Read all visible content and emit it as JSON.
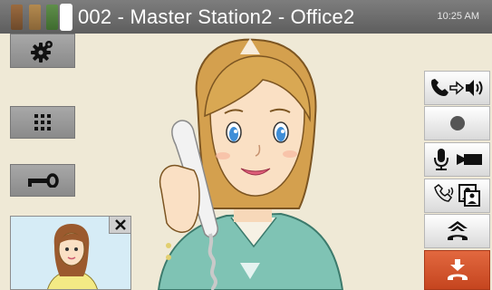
{
  "header": {
    "title": "002 - Master Station2 - Office2",
    "time": "10:25 AM"
  },
  "left_buttons": [
    {
      "name": "settings",
      "icon": "gear-icon"
    },
    {
      "name": "keypad",
      "icon": "keypad-icon"
    },
    {
      "name": "key",
      "icon": "key-icon"
    }
  ],
  "right_buttons": [
    {
      "name": "handset-speaker-switch",
      "icon": "handset-speaker-icon"
    },
    {
      "name": "record",
      "icon": "record-icon"
    },
    {
      "name": "mic-camera",
      "icon": "mic-camera-icon"
    },
    {
      "name": "transfer",
      "icon": "transfer-icon"
    },
    {
      "name": "hold",
      "icon": "hold-icon"
    },
    {
      "name": "hang-up",
      "icon": "hang-up-icon"
    }
  ],
  "pip": {
    "close_icon": "close-icon"
  },
  "colors": {
    "topbar": "#6d6d6d",
    "hangup": "#d45530",
    "background": "#efe9d6",
    "indicator_brown": "#7a5233",
    "indicator_tan": "#a17a44",
    "indicator_green": "#4e7c3c"
  }
}
